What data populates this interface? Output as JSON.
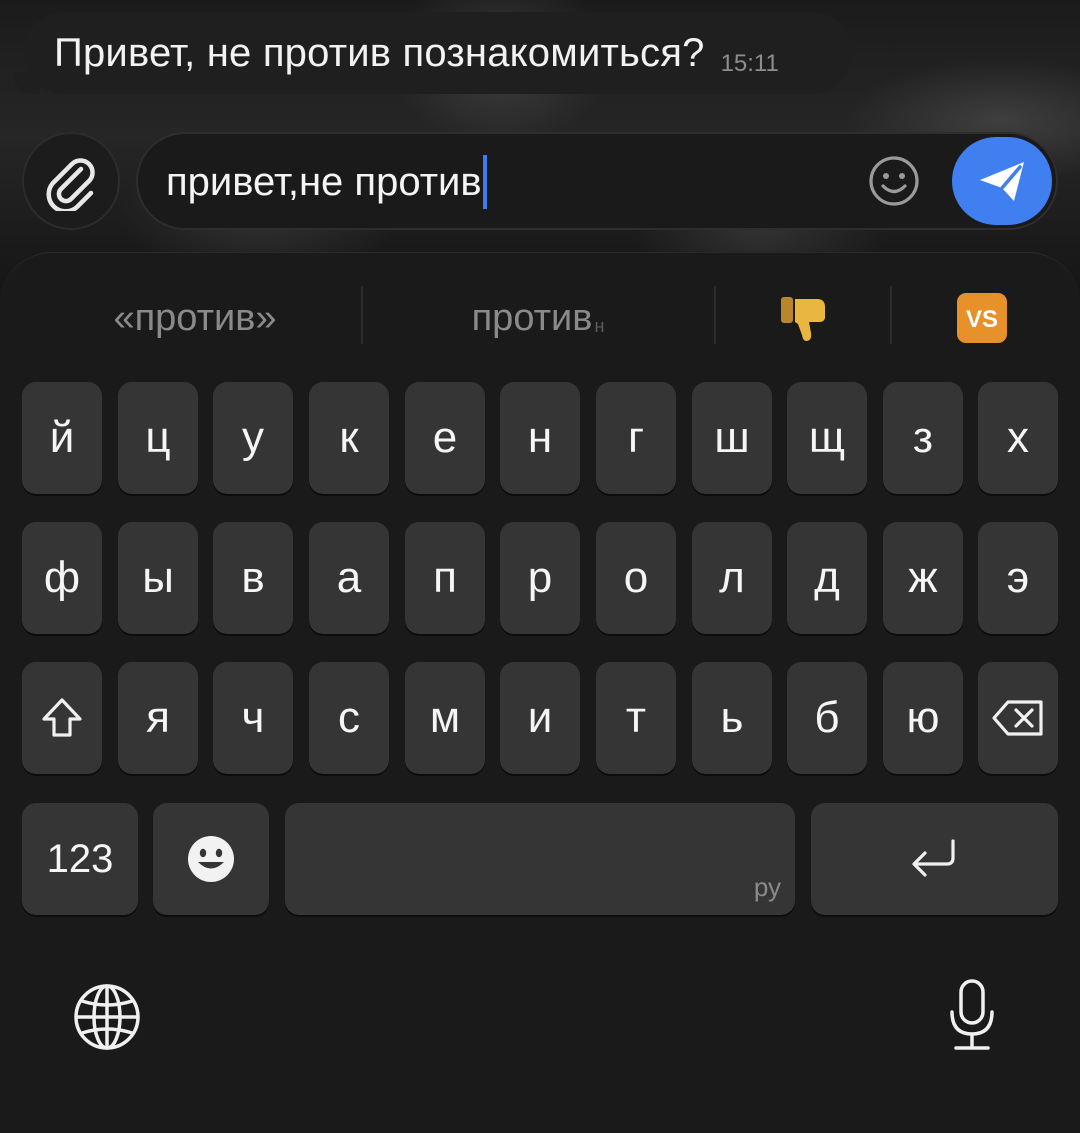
{
  "chat": {
    "message_text": "Привет, не против познакомиться?",
    "message_time": "15:11"
  },
  "composer": {
    "input_value": "привет,не против",
    "attach_icon": "paperclip-icon",
    "emoji_icon": "smiley-icon",
    "send_icon": "paper-plane-icon",
    "send_color": "#3f7ff0",
    "caret_color": "#3d7bf4"
  },
  "keyboard": {
    "suggestions": [
      {
        "label": "«против»"
      },
      {
        "label": "против",
        "suffix": "н"
      },
      {
        "emoji": "👎"
      },
      {
        "emoji": "🆚"
      }
    ],
    "row1": [
      "й",
      "ц",
      "у",
      "к",
      "е",
      "н",
      "г",
      "ш",
      "щ",
      "з",
      "х"
    ],
    "row2": [
      "ф",
      "ы",
      "в",
      "а",
      "п",
      "р",
      "о",
      "л",
      "д",
      "ж",
      "э"
    ],
    "row3": [
      "я",
      "ч",
      "с",
      "м",
      "и",
      "т",
      "ь",
      "б",
      "ю"
    ],
    "numbers_label": "123",
    "space_lang": "ру",
    "shift_icon": "shift-arrow-icon",
    "backspace_icon": "backspace-icon",
    "return_icon": "return-arrow-icon",
    "emoji_key_icon": "emoji-face-icon",
    "globe_icon": "globe-icon",
    "mic_icon": "microphone-icon"
  }
}
